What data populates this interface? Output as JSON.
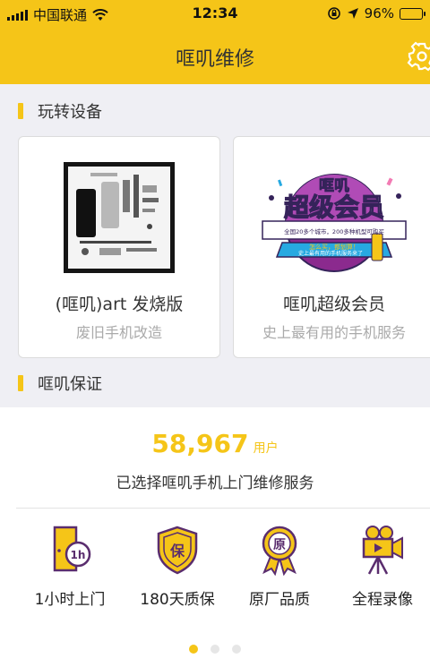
{
  "status_bar": {
    "carrier": "中国联通",
    "time": "12:34",
    "battery_text": "96%",
    "battery_level": 0.96
  },
  "nav": {
    "title": "哐叽维修"
  },
  "sections": {
    "devices_title": "玩转设备",
    "guarantee_title": "哐叽保证"
  },
  "cards": [
    {
      "title": "(哐叽)art 发烧版",
      "subtitle": "废旧手机改造"
    },
    {
      "title": "哐叽超级会员",
      "subtitle": "史上最有用的手机服务",
      "badge_title_1": "哐叽",
      "badge_title_2": "超级会员",
      "badge_line_1": "全国20多个城市，200多种机型可购买",
      "badge_line_2": "怎么买，都划算！",
      "badge_line_3": "史上最有用的手机服务来了"
    }
  ],
  "guarantee": {
    "count": "58,967",
    "count_unit": "用户",
    "service_text": "已选择哐叽手机上门维修服务",
    "features": [
      {
        "label": "1小时上门",
        "icon": "door-clock-icon",
        "icon_text": "1h"
      },
      {
        "label": "180天质保",
        "icon": "shield-icon",
        "icon_text": "保"
      },
      {
        "label": "原厂品质",
        "icon": "medal-icon",
        "icon_text": "原"
      },
      {
        "label": "全程录像",
        "icon": "video-camera-icon",
        "icon_text": ""
      }
    ],
    "pager": {
      "pages": 3,
      "active_index": 0
    }
  },
  "colors": {
    "accent": "#f5c518",
    "icon_purple": "#5a2d6e",
    "battery_green": "#27c93f",
    "background": "#efeff4"
  }
}
